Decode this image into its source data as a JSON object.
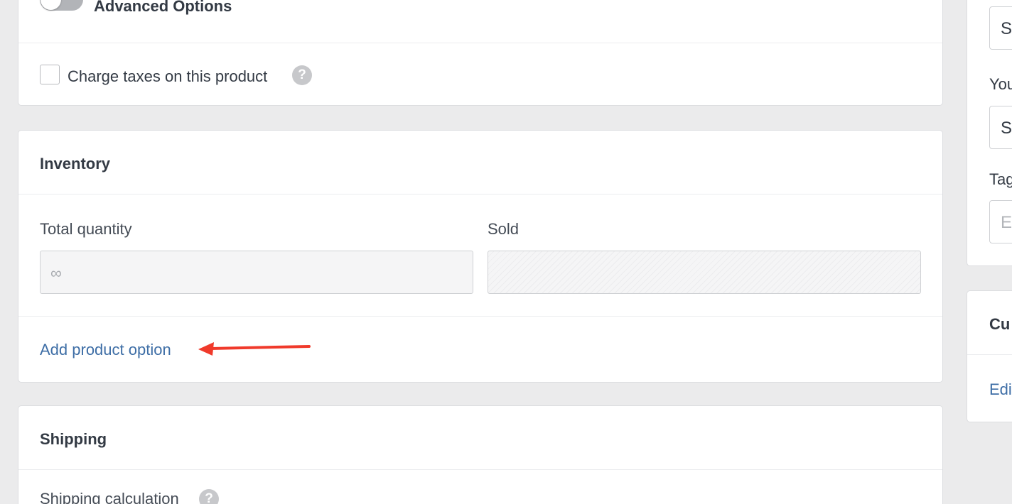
{
  "general": {
    "advanced_options_label": "Advanced Options",
    "advanced_options_on": false,
    "charge_taxes_label": "Charge taxes on this product",
    "charge_taxes_checked": false,
    "help_glyph": "?"
  },
  "inventory": {
    "title": "Inventory",
    "total_quantity_label": "Total quantity",
    "total_quantity_value": "∞",
    "sold_label": "Sold",
    "add_option_link": "Add product option"
  },
  "shipping": {
    "title": "Shipping",
    "calculation_label": "Shipping calculation"
  },
  "sidebar": {
    "select_1_value": "S",
    "label_2": "You",
    "select_2_value": "S",
    "tags_label": "Tag",
    "tags_placeholder": "E",
    "section_title": "Cu",
    "edit_link": "Edi"
  },
  "annotation": {
    "arrow_color": "#f03a2b",
    "arrow_icon": "red-arrow-left"
  },
  "colors": {
    "link": "#3e6ea6",
    "background": "#ebebec"
  }
}
